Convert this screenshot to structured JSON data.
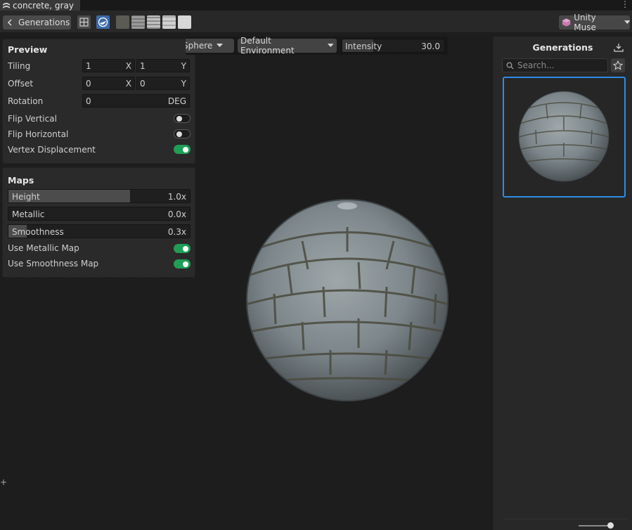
{
  "tab": {
    "title": "concrete, gray",
    "icon": "material-icon"
  },
  "toolbar": {
    "back_label": "Generations",
    "view_buttons": [
      "grid-view-icon",
      "sphere-view-icon"
    ],
    "map_thumbnails": [
      "albedo-map-thumb",
      "normal-map-thumb",
      "height-map-thumb",
      "metallic-map-thumb",
      "smoothness-map-thumb"
    ],
    "muse_label": "Unity Muse"
  },
  "preview": {
    "title": "Preview",
    "tiling": {
      "label": "Tiling",
      "x": "1",
      "x_unit": "X",
      "y": "1",
      "y_unit": "Y"
    },
    "offset": {
      "label": "Offset",
      "x": "0",
      "x_unit": "X",
      "y": "0",
      "y_unit": "Y"
    },
    "rotation": {
      "label": "Rotation",
      "value": "0",
      "unit": "DEG"
    },
    "flip_vertical": {
      "label": "Flip Vertical",
      "on": false
    },
    "flip_horizontal": {
      "label": "Flip Horizontal",
      "on": false
    },
    "vertex_displacement": {
      "label": "Vertex Displacement",
      "on": true
    }
  },
  "maps": {
    "title": "Maps",
    "height": {
      "label": "Height",
      "value": "1.0x",
      "fill_fraction": 0.67
    },
    "metallic": {
      "label": "Metallic",
      "value": "0.0x",
      "fill_fraction": 0.0
    },
    "smoothness": {
      "label": "Smoothness",
      "value": "0.3x",
      "fill_fraction": 0.1
    },
    "use_metallic": {
      "label": "Use Metallic Map",
      "on": true
    },
    "use_smoothness": {
      "label": "Use Smoothness Map",
      "on": true
    }
  },
  "view_controls": {
    "primitive": "Sphere",
    "environment": "Default Environment",
    "intensity_label": "Intensity",
    "intensity_value": "30.0"
  },
  "generations": {
    "title": "Generations",
    "search_placeholder": "Search...",
    "selected_index": 0
  },
  "colors": {
    "accent": "#2d8ce6",
    "toggle_on": "#1f9e58",
    "panel": "#2a2a2a"
  }
}
